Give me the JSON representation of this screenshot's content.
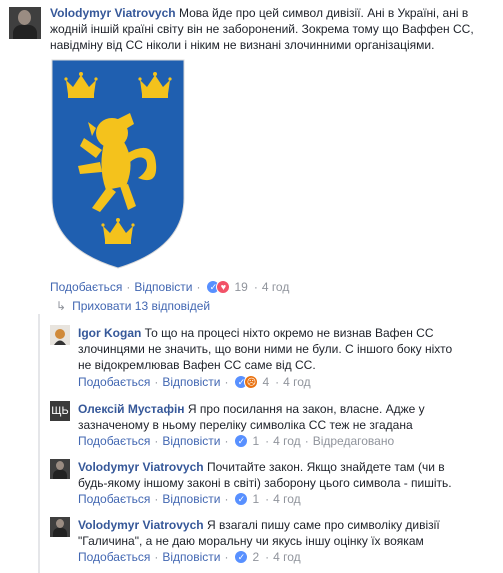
{
  "main_comment": {
    "author": "Volodymyr Viatrovych",
    "text_lines": [
      "Мова йде про цей символ дивізії. Ані в Україні, ані в",
      "жодній іншій країні світу він не заборонений. Зокрема тому що Ваффен СС,",
      "навідміну від СС ніколи і ніким не визнані злочинними організаціями."
    ],
    "like_label": "Подобається",
    "reply_label": "Відповісти",
    "reaction_count": "19",
    "time": "4 год"
  },
  "hide_replies_label": "Приховати 13 відповідей",
  "replies": [
    {
      "author": "Igor Kogan",
      "text_lines": [
        "То що на процесі ніхто окремо не визнав Вафен СС",
        "злочинцями не значить, що вони ними не були. С іншого боку ніхто",
        "не відокремлював Вафен СС саме від СС."
      ],
      "like_label": "Подобається",
      "reply_label": "Відповісти",
      "reaction_count": "4",
      "time": "4 год"
    },
    {
      "author": "Олексій Мустафін",
      "text_lines": [
        "Я про посилання на закон, власне. Адже у",
        "зазначеному в ньому переліку символіка СС теж не згадана"
      ],
      "like_label": "Подобається",
      "reply_label": "Відповісти",
      "reaction_count": "1",
      "time": "4 год",
      "edited_label": "Відредаговано",
      "avatar_glyph": "ЩЬ"
    },
    {
      "author": "Volodymyr Viatrovych",
      "text_lines": [
        "Почитайте закон. Якщо знайдете там (чи в",
        "будь-якому іншому законі в світі) заборону цього символа - пишіть."
      ],
      "like_label": "Подобається",
      "reply_label": "Відповісти",
      "reaction_count": "1",
      "time": "4 год"
    },
    {
      "author": "Volodymyr Viatrovych",
      "text_lines": [
        "Я взагалі пишу саме про символіку дивізії",
        "\"Галичина\", а не даю моральну чи якусь іншу оцінку їх воякам"
      ],
      "like_label": "Подобається",
      "reply_label": "Відповісти",
      "reaction_count": "2",
      "time": "4 год"
    }
  ],
  "emblem": {
    "field_color": "#1f5fb0",
    "charge_color": "#f4c21c"
  },
  "icons": {
    "like": "like-reaction-icon",
    "love": "love-reaction-icon",
    "angry": "angry-reaction-icon",
    "collapse": "collapse-arrow-icon"
  },
  "colors": {
    "link": "#4267b2",
    "name": "#365899",
    "meta": "#90949c"
  }
}
